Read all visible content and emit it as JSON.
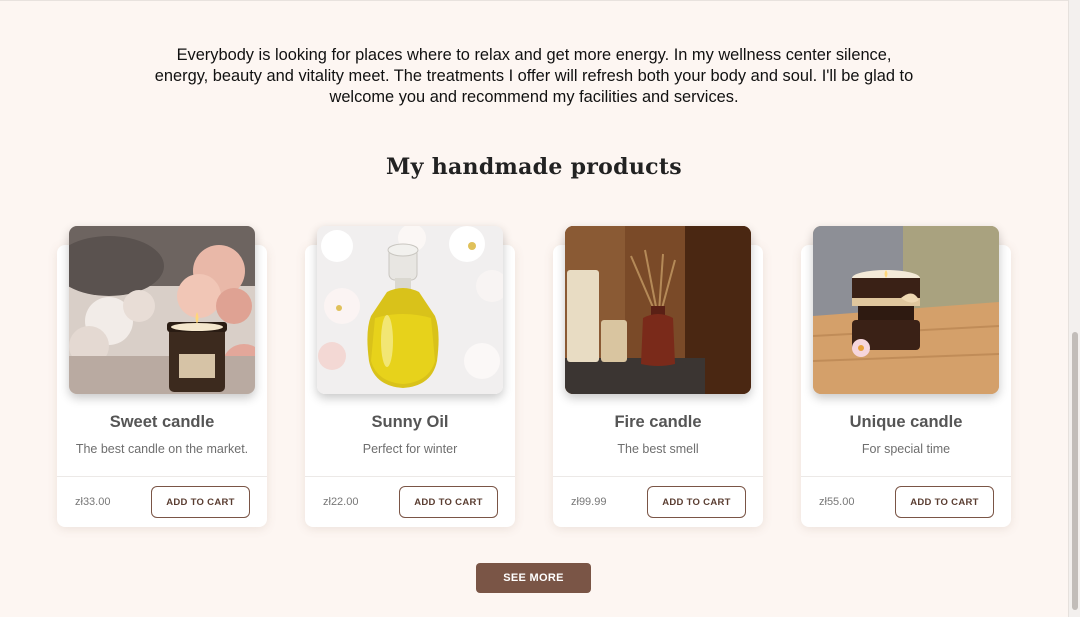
{
  "intro": {
    "text": "Everybody is looking for places where to relax and get more energy. In my wellness center silence, energy, beauty and vitality meet. The treatments I offer will refresh both your body and soul. I'll be glad to welcome you and recommend my facilities and services."
  },
  "products": {
    "title": "My handmade products",
    "items": [
      {
        "name": "Sweet candle",
        "description": "The best candle on the market.",
        "price": "zł33.00",
        "button": "ADD TO CART"
      },
      {
        "name": "Sunny Oil",
        "description": "Perfect for winter",
        "price": "zł22.00",
        "button": "ADD TO CART"
      },
      {
        "name": "Fire candle",
        "description": "The best smell",
        "price": "zł99.99",
        "button": "ADD TO CART"
      },
      {
        "name": "Unique candle",
        "description": "For special time",
        "price": "zł55.00",
        "button": "ADD TO CART"
      }
    ],
    "see_more_label": "SEE MORE"
  },
  "colors": {
    "background": "#fdf6f2",
    "accent": "#7a5546"
  }
}
